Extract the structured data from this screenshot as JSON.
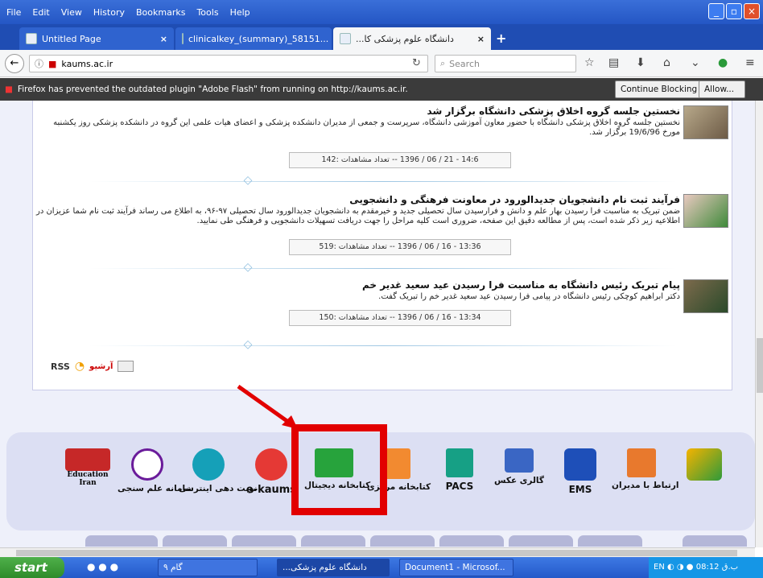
{
  "menu": [
    "File",
    "Edit",
    "View",
    "History",
    "Bookmarks",
    "Tools",
    "Help"
  ],
  "tabs": [
    {
      "label": "Untitled Page"
    },
    {
      "label": "clinicalkey_(summary)_58151..."
    },
    {
      "label": "...دانشگاه علوم پزشکی کا"
    }
  ],
  "url": "kaums.ac.ir",
  "search_placeholder": "Search",
  "plugin_bar": {
    "message": "Firefox has prevented the outdated plugin \"Adobe Flash\" from running on http://kaums.ac.ir.",
    "continue_label": "Continue Blocking",
    "allow_label": "Allow..."
  },
  "news": [
    {
      "title": "نخستین جلسه گروه اخلاق پزشکی دانشگاه برگزار شد",
      "desc": "نخستین جلسه گروه اخلاق پزشکی دانشگاه با حضور معاون آموزشی دانشگاه، سرپرست و جمعی از مدیران دانشکده پزشکی و اعضای هیات علمی این گروه در دانشکده پزشکی روز یکشنبه مورخ 19/6/96 برگزار شد.",
      "meta": "14:6 - 21 / 06 / 1396 -- تعداد مشاهدات :142"
    },
    {
      "title": "فرآیند ثبت نام دانشجویان جدیدالورود در معاونت فرهنگی و دانشجویی",
      "desc": "ضمن تبریک به مناسبت فرا رسیدن بهار علم و دانش و فرارسیدن سال تحصیلی جدید و خیرمقدم به دانشجویان جدیدالورود سال تحصیلی ۹۷-۹۶، به اطلاع می رساند فرآیند ثبت نام شما عزیزان در اطلاعیه زیر ذکر شده است، پس از مطالعه دقیق این صفحه، ضروری است کلیه مراحل را جهت دریافت تسهیلات دانشجویی و فرهنگی طی نمایید.",
      "meta": "13:36 - 16 / 06 / 1396 -- تعداد مشاهدات :519"
    },
    {
      "title": "پیام تبریک رئیس دانشگاه به مناسبت فرا رسیدن عید سعید غدیر خم",
      "desc": "دکتر ابراهیم کوچکی رئیس دانشگاه در پیامی فرا رسیدن عید سعید غدیر خم را تبریک گفت.",
      "meta": "13:34 - 16 / 06 / 1396 -- تعداد مشاهدات :150"
    }
  ],
  "archive": {
    "rss": "RSS",
    "label": "آرشیو"
  },
  "services": [
    {
      "label": "سامانه علم سنجی",
      "icon": "flower-icon",
      "caption": "Education Iran"
    },
    {
      "label": "",
      "icon": "iran-map-icon"
    },
    {
      "label": "نوبت دهی اینترنتی",
      "icon": "phone-icon"
    },
    {
      "label": "e-kaums",
      "icon": "power-icon"
    },
    {
      "label": "کتابخانه دیجیتال",
      "icon": "digital-library-icon"
    },
    {
      "label": "کتابخانه مرکزی",
      "icon": "book-icon"
    },
    {
      "label": "PACS",
      "icon": "pulse-icon"
    },
    {
      "label": "گالری عکس",
      "icon": "gallery-icon"
    },
    {
      "label": "EMS",
      "icon": "star-of-life-icon"
    },
    {
      "label": "ارتباط با مدیران",
      "icon": "contact-icon"
    }
  ],
  "taskbar": {
    "start": "start",
    "tasks": [
      "گام ۹",
      "...دانشگاه علوم پزشکی",
      "Document1 - Microsof..."
    ],
    "clock": "08:12 ب.ق",
    "lang": "EN"
  },
  "colors": {
    "highlight": "#e20000",
    "band": "#dcdff3"
  }
}
